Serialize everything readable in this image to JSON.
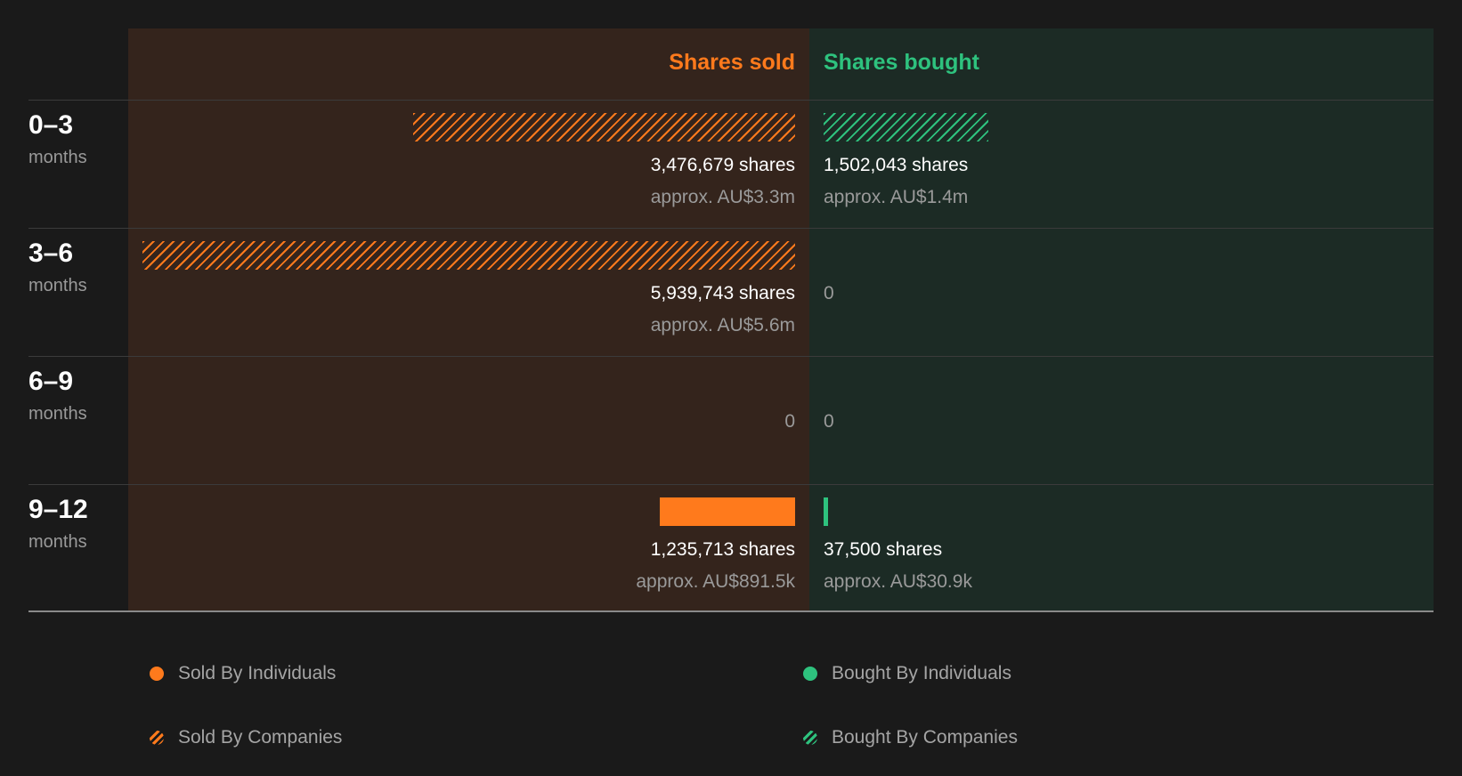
{
  "colors": {
    "sold": "#ff7a1c",
    "bought": "#2ec27e",
    "background": "#1a1a1a"
  },
  "chart_data": {
    "type": "bar",
    "orientation": "horizontal-diverging",
    "column_headers": {
      "sold": "Shares sold",
      "bought": "Shares bought"
    },
    "rows": [
      {
        "range": "0–3",
        "unit": "months",
        "sold": {
          "shares": 3476679,
          "shares_label": "3,476,679 shares",
          "approx_label": "approx. AU$3.3m",
          "type": "companies"
        },
        "bought": {
          "shares": 1502043,
          "shares_label": "1,502,043 shares",
          "approx_label": "approx. AU$1.4m",
          "type": "companies"
        }
      },
      {
        "range": "3–6",
        "unit": "months",
        "sold": {
          "shares": 5939743,
          "shares_label": "5,939,743 shares",
          "approx_label": "approx. AU$5.6m",
          "type": "companies"
        },
        "bought": {
          "shares": 0,
          "shares_label": "0",
          "approx_label": "",
          "type": "none"
        }
      },
      {
        "range": "6–9",
        "unit": "months",
        "sold": {
          "shares": 0,
          "shares_label": "0",
          "approx_label": "",
          "type": "none"
        },
        "bought": {
          "shares": 0,
          "shares_label": "0",
          "approx_label": "",
          "type": "none"
        }
      },
      {
        "range": "9–12",
        "unit": "months",
        "sold": {
          "shares": 1235713,
          "shares_label": "1,235,713 shares",
          "approx_label": "approx. AU$891.5k",
          "type": "individuals"
        },
        "bought": {
          "shares": 37500,
          "shares_label": "37,500 shares",
          "approx_label": "approx. AU$30.9k",
          "type": "individuals"
        }
      }
    ],
    "legend": [
      {
        "key": "sold-ind",
        "label": "Sold By Individuals"
      },
      {
        "key": "bought-ind",
        "label": "Bought By Individuals"
      },
      {
        "key": "sold-comp",
        "label": "Sold By Companies"
      },
      {
        "key": "bought-comp",
        "label": "Bought By Companies"
      }
    ]
  }
}
